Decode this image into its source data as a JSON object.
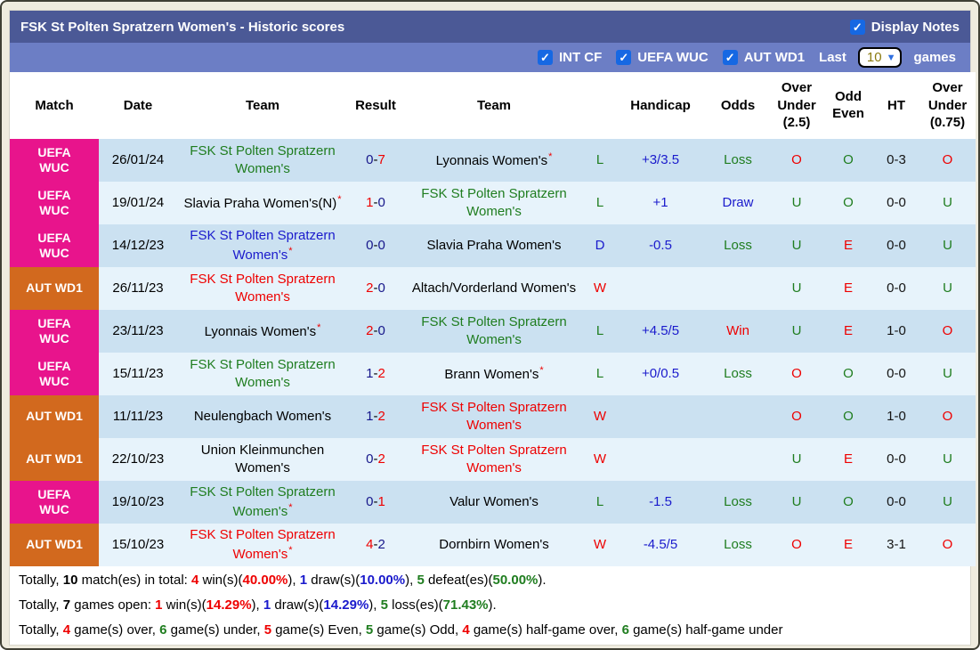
{
  "palette": {
    "red": "#ee0000",
    "green": "#1f7d1f",
    "blue": "#1a1acc",
    "navy": "#16168a",
    "black": "#000000",
    "uefa": "#e8148c",
    "aut": "#d2691e"
  },
  "icons": {
    "check": "✓",
    "chevron_down": "▼"
  },
  "header": {
    "title": "FSK St Polten Spratzern Women's - Historic scores",
    "display_notes_label": "Display Notes",
    "display_notes_checked": true
  },
  "filterbar": {
    "filters": [
      {
        "label": "INT CF",
        "checked": true
      },
      {
        "label": "UEFA WUC",
        "checked": true
      },
      {
        "label": "AUT WD1",
        "checked": true
      }
    ],
    "last_label": "Last",
    "last_value": "10",
    "games_label": "games"
  },
  "table": {
    "score_separator": "-",
    "headers": [
      "Match",
      "Date",
      "Team",
      "Result",
      "Team",
      "",
      "Handicap",
      "Odds",
      "Over\nUnder\n(2.5)",
      "Odd\nEven",
      "HT",
      "Over\nUnder\n(0.75)"
    ],
    "rows": [
      {
        "league": "UEFA\nWUC",
        "league_type": "uefa",
        "date": "26/01/24",
        "home": {
          "name": "FSK St Polten Spratzern Women's",
          "color": "green",
          "star": false
        },
        "score": {
          "h": "0",
          "h_color": "navy",
          "a": "7",
          "a_color": "red"
        },
        "away": {
          "name": "Lyonnais Women's",
          "color": "black",
          "star": true
        },
        "wdl": {
          "text": "L",
          "color": "green"
        },
        "handicap": "+3/3.5",
        "odds": {
          "text": "Loss",
          "color": "green"
        },
        "over_under_25": {
          "text": "O",
          "color": "red"
        },
        "odd_even": {
          "text": "O",
          "color": "green"
        },
        "ht": "0-3",
        "over_under_075": {
          "text": "O",
          "color": "red"
        }
      },
      {
        "league": "UEFA\nWUC",
        "league_type": "uefa",
        "date": "19/01/24",
        "home": {
          "name": "Slavia Praha Women's(N)",
          "color": "black",
          "star": true
        },
        "score": {
          "h": "1",
          "h_color": "red",
          "a": "0",
          "a_color": "navy"
        },
        "away": {
          "name": "FSK St Polten Spratzern Women's",
          "color": "green",
          "star": false
        },
        "wdl": {
          "text": "L",
          "color": "green"
        },
        "handicap": "+1",
        "odds": {
          "text": "Draw",
          "color": "blue"
        },
        "over_under_25": {
          "text": "U",
          "color": "green"
        },
        "odd_even": {
          "text": "O",
          "color": "green"
        },
        "ht": "0-0",
        "over_under_075": {
          "text": "U",
          "color": "green"
        }
      },
      {
        "league": "UEFA\nWUC",
        "league_type": "uefa",
        "date": "14/12/23",
        "home": {
          "name": "FSK St Polten Spratzern Women's",
          "color": "blue",
          "star": true
        },
        "score": {
          "h": "0",
          "h_color": "navy",
          "a": "0",
          "a_color": "navy"
        },
        "away": {
          "name": "Slavia Praha Women's",
          "color": "black",
          "star": false
        },
        "wdl": {
          "text": "D",
          "color": "blue"
        },
        "handicap": "-0.5",
        "odds": {
          "text": "Loss",
          "color": "green"
        },
        "over_under_25": {
          "text": "U",
          "color": "green"
        },
        "odd_even": {
          "text": "E",
          "color": "red"
        },
        "ht": "0-0",
        "over_under_075": {
          "text": "U",
          "color": "green"
        }
      },
      {
        "league": "AUT WD1",
        "league_type": "aut",
        "date": "26/11/23",
        "home": {
          "name": "FSK St Polten Spratzern Women's",
          "color": "red",
          "star": false
        },
        "score": {
          "h": "2",
          "h_color": "red",
          "a": "0",
          "a_color": "navy"
        },
        "away": {
          "name": "Altach/Vorderland Women's",
          "color": "black",
          "star": false
        },
        "wdl": {
          "text": "W",
          "color": "red"
        },
        "handicap": "",
        "odds": {
          "text": "",
          "color": "black"
        },
        "over_under_25": {
          "text": "U",
          "color": "green"
        },
        "odd_even": {
          "text": "E",
          "color": "red"
        },
        "ht": "0-0",
        "over_under_075": {
          "text": "U",
          "color": "green"
        }
      },
      {
        "league": "UEFA\nWUC",
        "league_type": "uefa",
        "date": "23/11/23",
        "home": {
          "name": "Lyonnais Women's",
          "color": "black",
          "star": true
        },
        "score": {
          "h": "2",
          "h_color": "red",
          "a": "0",
          "a_color": "navy"
        },
        "away": {
          "name": "FSK St Polten Spratzern Women's",
          "color": "green",
          "star": false
        },
        "wdl": {
          "text": "L",
          "color": "green"
        },
        "handicap": "+4.5/5",
        "odds": {
          "text": "Win",
          "color": "red"
        },
        "over_under_25": {
          "text": "U",
          "color": "green"
        },
        "odd_even": {
          "text": "E",
          "color": "red"
        },
        "ht": "1-0",
        "over_under_075": {
          "text": "O",
          "color": "red"
        }
      },
      {
        "league": "UEFA\nWUC",
        "league_type": "uefa",
        "date": "15/11/23",
        "home": {
          "name": "FSK St Polten Spratzern Women's",
          "color": "green",
          "star": false
        },
        "score": {
          "h": "1",
          "h_color": "navy",
          "a": "2",
          "a_color": "red"
        },
        "away": {
          "name": "Brann Women's",
          "color": "black",
          "star": true
        },
        "wdl": {
          "text": "L",
          "color": "green"
        },
        "handicap": "+0/0.5",
        "odds": {
          "text": "Loss",
          "color": "green"
        },
        "over_under_25": {
          "text": "O",
          "color": "red"
        },
        "odd_even": {
          "text": "O",
          "color": "green"
        },
        "ht": "0-0",
        "over_under_075": {
          "text": "U",
          "color": "green"
        }
      },
      {
        "league": "AUT WD1",
        "league_type": "aut",
        "date": "11/11/23",
        "home": {
          "name": "Neulengbach Women's",
          "color": "black",
          "star": false
        },
        "score": {
          "h": "1",
          "h_color": "navy",
          "a": "2",
          "a_color": "red"
        },
        "away": {
          "name": "FSK St Polten Spratzern Women's",
          "color": "red",
          "star": false
        },
        "wdl": {
          "text": "W",
          "color": "red"
        },
        "handicap": "",
        "odds": {
          "text": "",
          "color": "black"
        },
        "over_under_25": {
          "text": "O",
          "color": "red"
        },
        "odd_even": {
          "text": "O",
          "color": "green"
        },
        "ht": "1-0",
        "over_under_075": {
          "text": "O",
          "color": "red"
        }
      },
      {
        "league": "AUT WD1",
        "league_type": "aut",
        "date": "22/10/23",
        "home": {
          "name": "Union Kleinmunchen Women's",
          "color": "black",
          "star": false
        },
        "score": {
          "h": "0",
          "h_color": "navy",
          "a": "2",
          "a_color": "red"
        },
        "away": {
          "name": "FSK St Polten Spratzern Women's",
          "color": "red",
          "star": false
        },
        "wdl": {
          "text": "W",
          "color": "red"
        },
        "handicap": "",
        "odds": {
          "text": "",
          "color": "black"
        },
        "over_under_25": {
          "text": "U",
          "color": "green"
        },
        "odd_even": {
          "text": "E",
          "color": "red"
        },
        "ht": "0-0",
        "over_under_075": {
          "text": "U",
          "color": "green"
        }
      },
      {
        "league": "UEFA\nWUC",
        "league_type": "uefa",
        "date": "19/10/23",
        "home": {
          "name": "FSK St Polten Spratzern Women's",
          "color": "green",
          "star": true
        },
        "score": {
          "h": "0",
          "h_color": "navy",
          "a": "1",
          "a_color": "red"
        },
        "away": {
          "name": "Valur Women's",
          "color": "black",
          "star": false
        },
        "wdl": {
          "text": "L",
          "color": "green"
        },
        "handicap": "-1.5",
        "odds": {
          "text": "Loss",
          "color": "green"
        },
        "over_under_25": {
          "text": "U",
          "color": "green"
        },
        "odd_even": {
          "text": "O",
          "color": "green"
        },
        "ht": "0-0",
        "over_under_075": {
          "text": "U",
          "color": "green"
        }
      },
      {
        "league": "AUT WD1",
        "league_type": "aut",
        "date": "15/10/23",
        "home": {
          "name": "FSK St Polten Spratzern Women's",
          "color": "red",
          "star": true
        },
        "score": {
          "h": "4",
          "h_color": "red",
          "a": "2",
          "a_color": "navy"
        },
        "away": {
          "name": "Dornbirn Women's",
          "color": "black",
          "star": false
        },
        "wdl": {
          "text": "W",
          "color": "red"
        },
        "handicap": "-4.5/5",
        "odds": {
          "text": "Loss",
          "color": "green"
        },
        "over_under_25": {
          "text": "O",
          "color": "red"
        },
        "odd_even": {
          "text": "E",
          "color": "red"
        },
        "ht": "3-1",
        "over_under_075": {
          "text": "O",
          "color": "red"
        }
      }
    ]
  },
  "summary": [
    [
      {
        "t": "Totally, "
      },
      {
        "t": "10",
        "b": 1
      },
      {
        "t": " match(es) in total: "
      },
      {
        "t": "4",
        "c": "red",
        "b": 1
      },
      {
        "t": " win(s)("
      },
      {
        "t": "40.00%",
        "c": "red",
        "b": 1
      },
      {
        "t": "), "
      },
      {
        "t": "1",
        "c": "blue",
        "b": 1
      },
      {
        "t": " draw(s)("
      },
      {
        "t": "10.00%",
        "c": "blue",
        "b": 1
      },
      {
        "t": "), "
      },
      {
        "t": "5",
        "c": "green",
        "b": 1
      },
      {
        "t": " defeat(es)("
      },
      {
        "t": "50.00%",
        "c": "green",
        "b": 1
      },
      {
        "t": ")."
      }
    ],
    [
      {
        "t": "Totally, "
      },
      {
        "t": "7",
        "b": 1
      },
      {
        "t": " games open: "
      },
      {
        "t": "1",
        "c": "red",
        "b": 1
      },
      {
        "t": " win(s)("
      },
      {
        "t": "14.29%",
        "c": "red",
        "b": 1
      },
      {
        "t": "), "
      },
      {
        "t": "1",
        "c": "blue",
        "b": 1
      },
      {
        "t": " draw(s)("
      },
      {
        "t": "14.29%",
        "c": "blue",
        "b": 1
      },
      {
        "t": "), "
      },
      {
        "t": "5",
        "c": "green",
        "b": 1
      },
      {
        "t": " loss(es)("
      },
      {
        "t": "71.43%",
        "c": "green",
        "b": 1
      },
      {
        "t": ")."
      }
    ],
    [
      {
        "t": "Totally, "
      },
      {
        "t": "4",
        "c": "red",
        "b": 1
      },
      {
        "t": " game(s) over, "
      },
      {
        "t": "6",
        "c": "green",
        "b": 1
      },
      {
        "t": " game(s) under, "
      },
      {
        "t": "5",
        "c": "red",
        "b": 1
      },
      {
        "t": " game(s) Even, "
      },
      {
        "t": "5",
        "c": "green",
        "b": 1
      },
      {
        "t": " game(s) Odd, "
      },
      {
        "t": "4",
        "c": "red",
        "b": 1
      },
      {
        "t": " game(s) half-game over, "
      },
      {
        "t": "6",
        "c": "green",
        "b": 1
      },
      {
        "t": " game(s) half-game under"
      }
    ]
  ]
}
